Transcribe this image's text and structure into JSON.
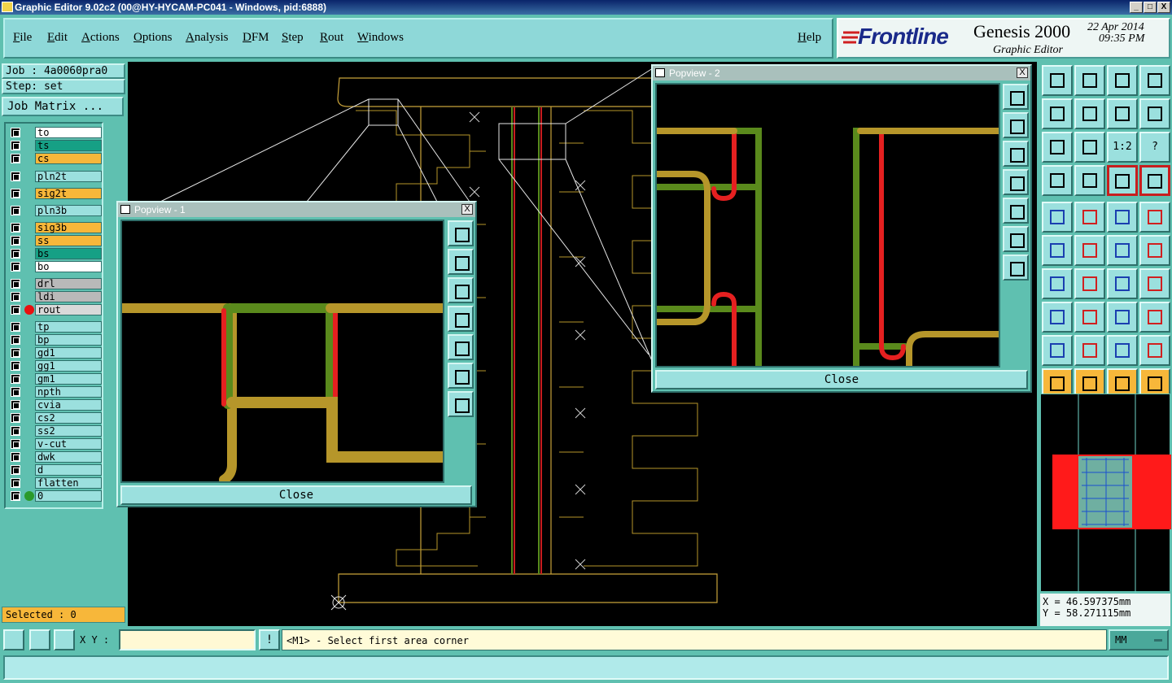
{
  "window": {
    "title": "Graphic Editor 9.02c2 (00@HY-HYCAM-PC041 - Windows, pid:6888)",
    "buttons": [
      "_",
      "□",
      "X"
    ]
  },
  "menu": {
    "items": [
      "File",
      "Edit",
      "Actions",
      "Options",
      "Analysis",
      "DFM",
      "Step",
      "Rout",
      "Windows"
    ],
    "help": "Help"
  },
  "brand": {
    "logo": "Frontline",
    "product": "Genesis 2000",
    "date": "22 Apr 2014",
    "time": "09:35 PM",
    "subtitle": "Graphic Editor"
  },
  "left_panel": {
    "job": "Job : 4a0060pra0",
    "step": "Step: set",
    "job_matrix": "Job Matrix ...",
    "layers": [
      {
        "name": "to",
        "color": "#ffffff"
      },
      {
        "name": "ts",
        "color": "#16a085"
      },
      {
        "name": "cs",
        "color": "#f7b73a"
      },
      {
        "name": "pln2t",
        "color": "#9be0de"
      },
      {
        "name": "sig2t",
        "color": "#f7b73a"
      },
      {
        "name": "pln3b",
        "color": "#9be0de"
      },
      {
        "name": "sig3b",
        "color": "#f7b73a"
      },
      {
        "name": "ss",
        "color": "#f7b73a"
      },
      {
        "name": "bs",
        "color": "#16a085"
      },
      {
        "name": "bo",
        "color": "#ffffff"
      },
      {
        "name": "drl",
        "color": "#b9b9b9"
      },
      {
        "name": "ldi",
        "color": "#b9b9b9"
      },
      {
        "name": "rout",
        "color": "#d9d9d9"
      },
      {
        "name": "tp",
        "color": "#9be0de"
      },
      {
        "name": "bp",
        "color": "#9be0de"
      },
      {
        "name": "gd1",
        "color": "#9be0de"
      },
      {
        "name": "gg1",
        "color": "#9be0de"
      },
      {
        "name": "gm1",
        "color": "#9be0de"
      },
      {
        "name": "npth",
        "color": "#9be0de"
      },
      {
        "name": "cvia",
        "color": "#9be0de"
      },
      {
        "name": "cs2",
        "color": "#9be0de"
      },
      {
        "name": "ss2",
        "color": "#9be0de"
      },
      {
        "name": "v-cut",
        "color": "#9be0de"
      },
      {
        "name": "dwk",
        "color": "#9be0de"
      },
      {
        "name": "d",
        "color": "#9be0de"
      },
      {
        "name": "flatten",
        "color": "#9be0de"
      },
      {
        "name": "0",
        "color": "#9be0de"
      }
    ],
    "selected": "Selected : 0"
  },
  "popview1": {
    "title": "Popview - 1",
    "close": "Close",
    "close_x": "X"
  },
  "popview2": {
    "title": "Popview - 2",
    "close": "Close",
    "close_x": "X"
  },
  "toolbox": {
    "icons": [
      "zoom-home-icon",
      "zoom-fit-icon",
      "home-icon",
      "split-view-icon",
      "pan-left-icon",
      "pan-right-icon",
      "undo-view-icon",
      "redraw-icon",
      "zoom-in-icon",
      "center-icon",
      "scale-1-2-icon",
      "help-query-icon",
      "tools-icon",
      "grid-icon",
      "layers-a-icon",
      "layers-b-icon",
      "select-feature-icon",
      "measure-icon",
      "ruler-icon",
      "snap-point-icon",
      "connect-icon",
      "cut-icon",
      "add-pad-icon",
      "move-pad-icon",
      "angle-icon",
      "line-icon",
      "arc-icon",
      "fit-icon",
      "pad-select-icon",
      "line-select-icon",
      "box-select-icon",
      "group-icon",
      "triangle-a-icon",
      "triangle-b-icon",
      "triangle-c-icon",
      "triangle-d-icon",
      "pointer-icon",
      "pointer-box-icon",
      "pointer-frame-icon",
      "path-icon"
    ],
    "scale_label": "1:2",
    "help_label": "?"
  },
  "coords": {
    "x": "X = 46.597375mm",
    "y": "Y = 58.271115mm"
  },
  "status": {
    "xy_label": "X Y :",
    "xy_value": "",
    "info_icon": "!",
    "message": "<M1> - Select first area corner",
    "units": "MM"
  }
}
